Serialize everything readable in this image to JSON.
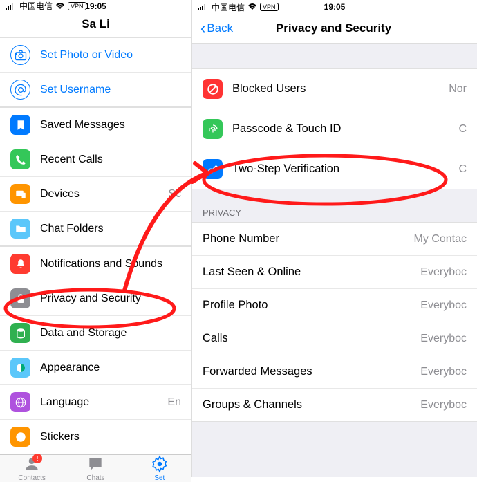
{
  "left": {
    "status": {
      "carrier": "中国电信",
      "time": "19:05",
      "vpn": "VPN"
    },
    "profile_name": "Sa Li",
    "set_photo": "Set Photo or Video",
    "set_username": "Set Username",
    "group1": {
      "saved": "Saved Messages",
      "calls": "Recent Calls",
      "devices": "Devices",
      "devices_value": "Sc",
      "folders": "Chat Folders"
    },
    "group2": {
      "notifications": "Notifications and Sounds",
      "privacy": "Privacy and Security",
      "data": "Data and Storage",
      "appearance": "Appearance",
      "language": "Language",
      "language_value": "En",
      "stickers": "Stickers"
    },
    "tabs": {
      "contacts": "Contacts",
      "chats": "Chats",
      "settings": "Set",
      "badge": "!"
    }
  },
  "right": {
    "status": {
      "carrier": "中国电信",
      "time": "19:05",
      "vpn": "VPN"
    },
    "back": "Back",
    "title": "Privacy and Security",
    "security_section": {
      "blocked": "Blocked Users",
      "blocked_value": "Nor",
      "passcode": "Passcode & Touch ID",
      "passcode_value": "C",
      "twostep": "Two-Step Verification",
      "twostep_value": "C"
    },
    "privacy_header": "PRIVACY",
    "privacy_section": {
      "phone": "Phone Number",
      "phone_value": "My Contac",
      "lastseen": "Last Seen & Online",
      "lastseen_value": "Everyboc",
      "photo": "Profile Photo",
      "photo_value": "Everyboc",
      "calls": "Calls",
      "calls_value": "Everyboc",
      "forwarded": "Forwarded Messages",
      "forwarded_value": "Everyboc",
      "groups": "Groups & Channels",
      "groups_value": "Everyboc"
    }
  }
}
